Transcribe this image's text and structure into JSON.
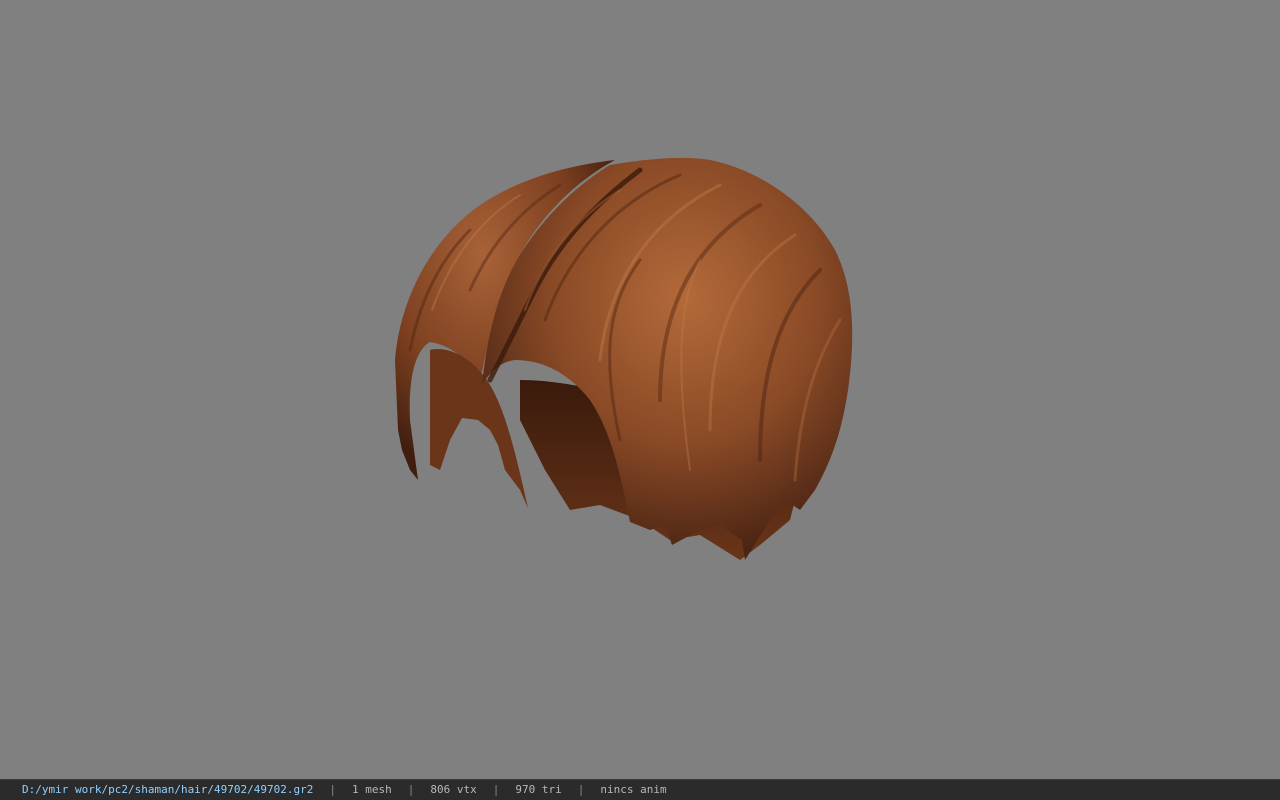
{
  "viewer": {
    "background_color": "#808080",
    "model": {
      "name": "hair-model",
      "colors": {
        "base": "#8a4a26",
        "highlight": "#b36a3a",
        "shadow": "#4a2414",
        "underside": "#5e2f18"
      }
    }
  },
  "statusbar": {
    "path": "D:/ymir work/pc2/shaman/hair/49702/49702.gr2",
    "separator": "|",
    "mesh": "1 mesh",
    "vtx": "806 vtx",
    "tri": "970 tri",
    "anim": "nincs anim"
  }
}
